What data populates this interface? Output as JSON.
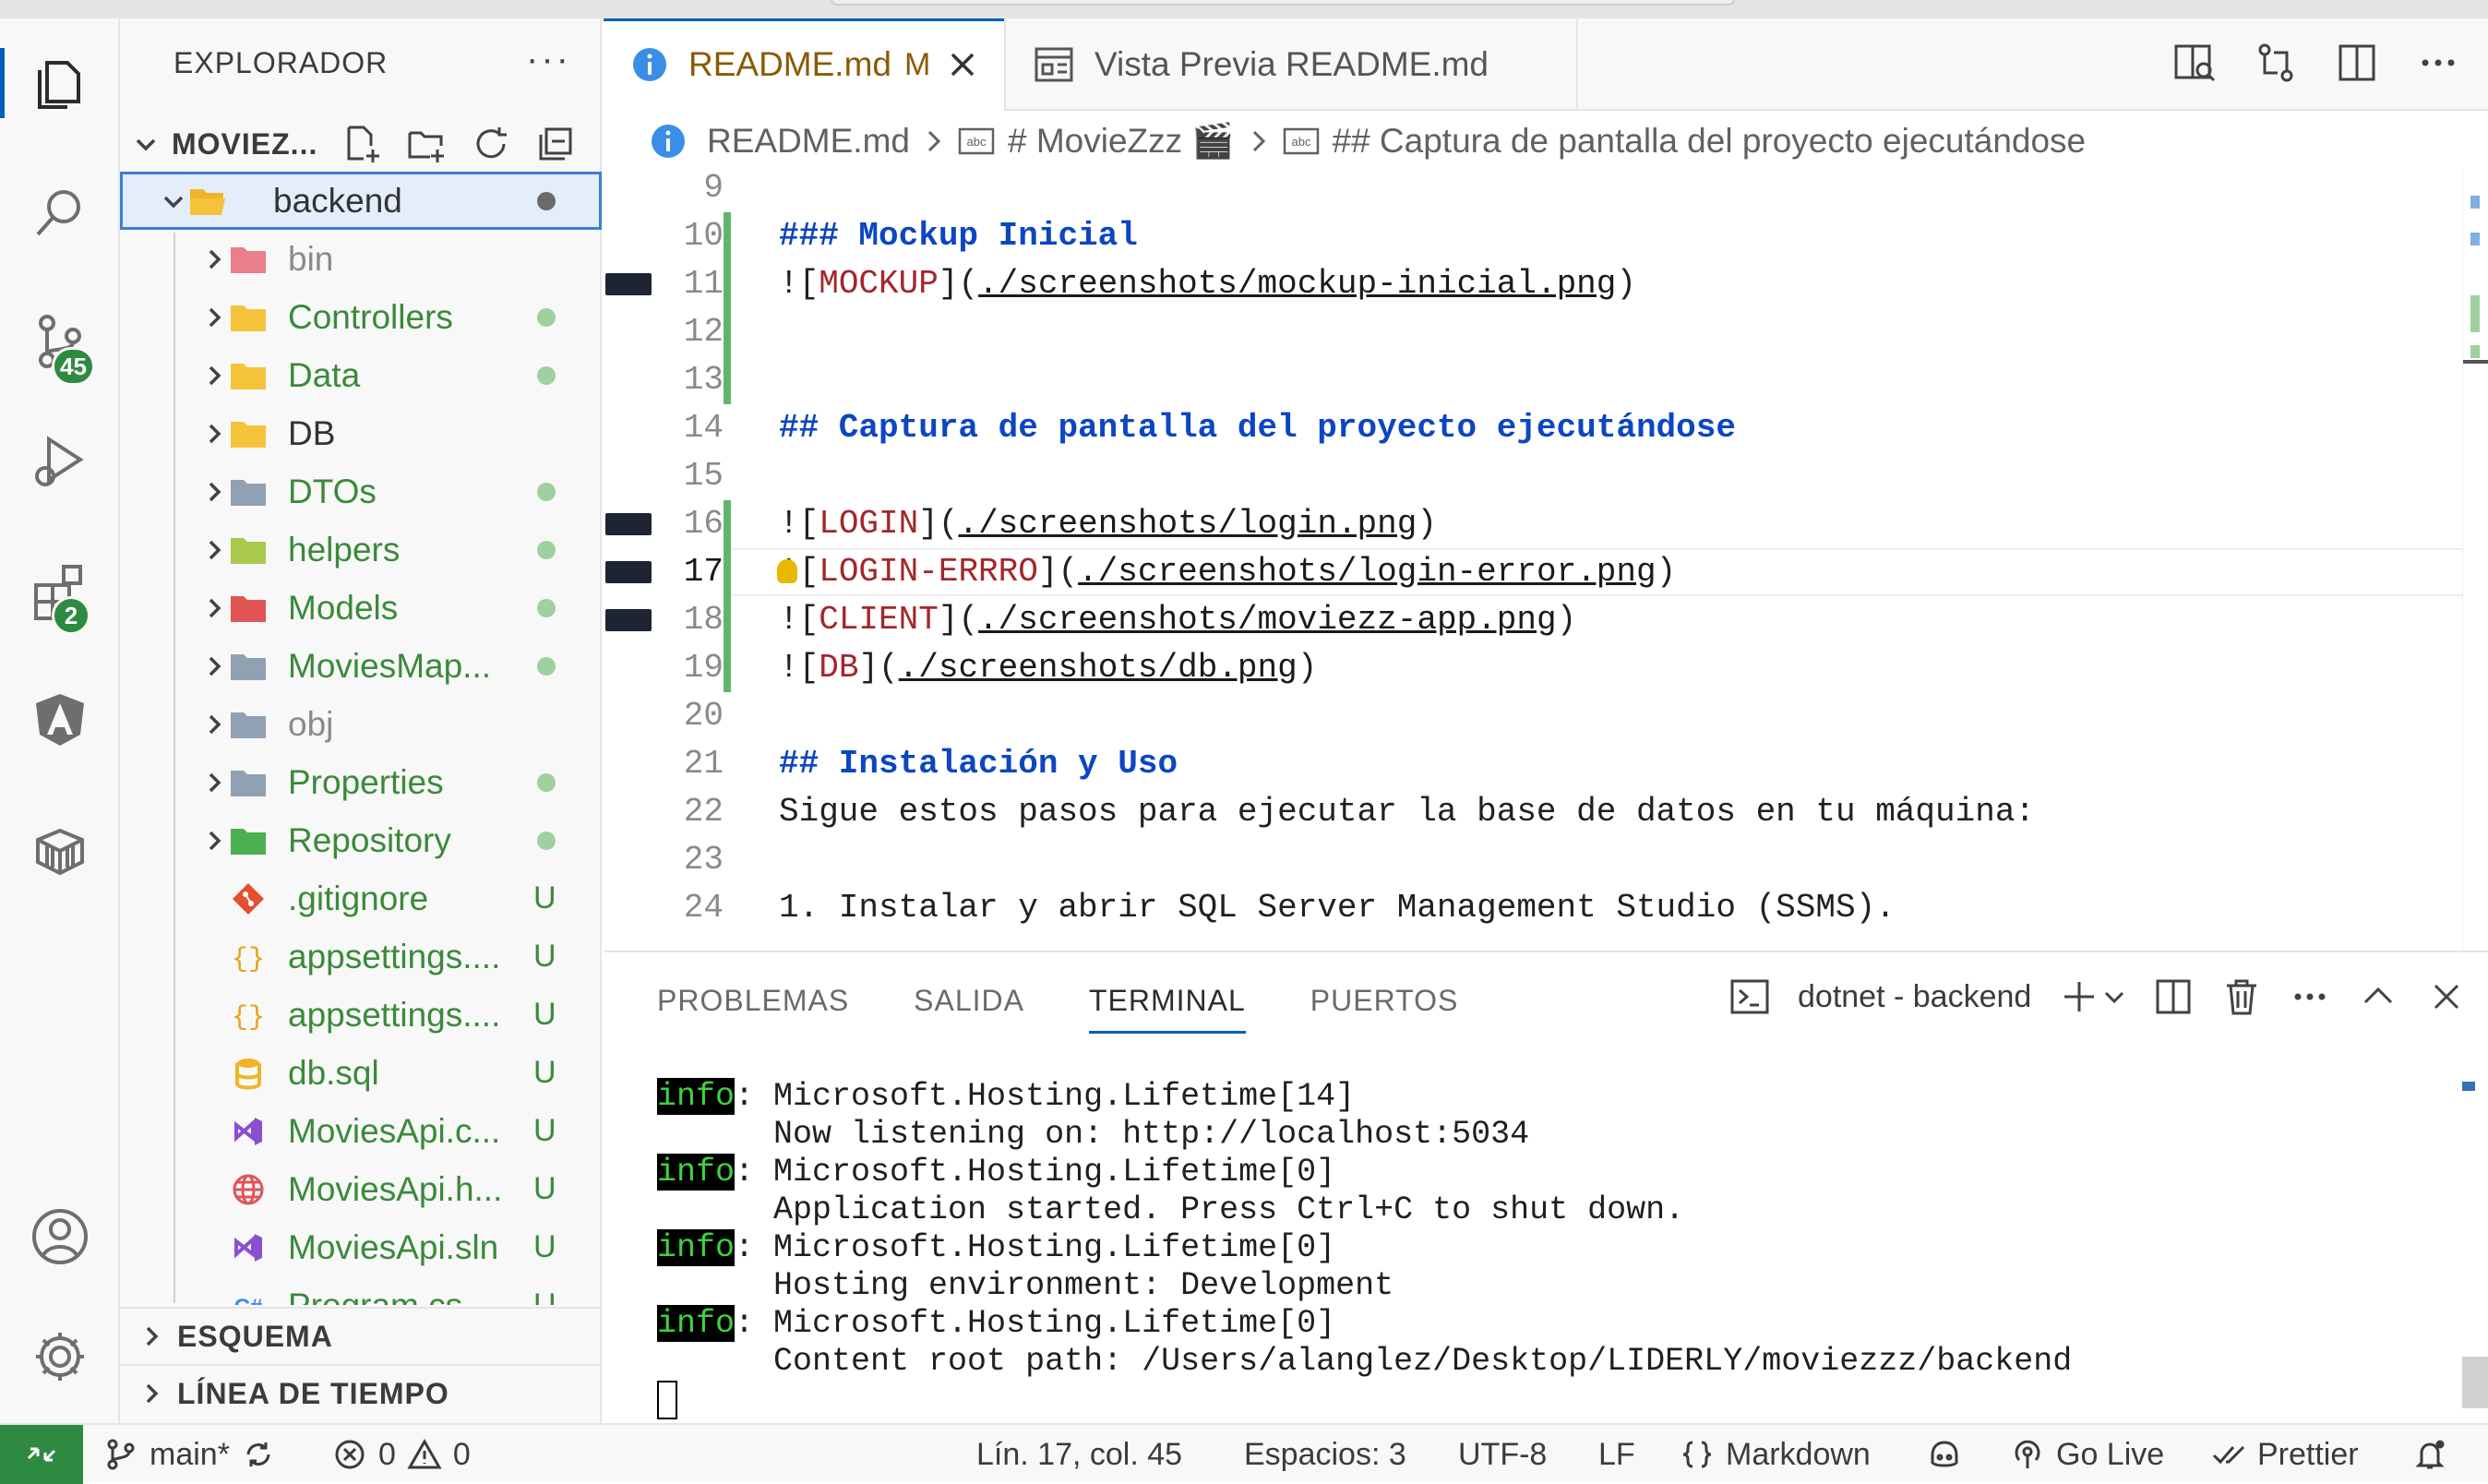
{
  "sidebar": {
    "title": "EXPLORADOR",
    "more": "···",
    "root": "MOVIEZ...",
    "items": [
      {
        "label": "backend",
        "type": "folder-open",
        "level": 0,
        "status": "dot-gray",
        "color": "#333333"
      },
      {
        "label": "bin",
        "type": "folder",
        "level": 1,
        "status": "",
        "color": "#8a8a8a",
        "icon_color": "#e87f8a"
      },
      {
        "label": "Controllers",
        "type": "folder",
        "level": 1,
        "status": "dot",
        "color": "#3a8a3a",
        "icon_color": "#f5c33b"
      },
      {
        "label": "Data",
        "type": "folder",
        "level": 1,
        "status": "dot",
        "color": "#3a8a3a",
        "icon_color": "#f5c33b"
      },
      {
        "label": "DB",
        "type": "folder",
        "level": 1,
        "status": "",
        "color": "#333333",
        "icon_color": "#f5c33b"
      },
      {
        "label": "DTOs",
        "type": "folder",
        "level": 1,
        "status": "dot",
        "color": "#3a8a3a",
        "icon_color": "#8fa1b3"
      },
      {
        "label": "helpers",
        "type": "folder",
        "level": 1,
        "status": "dot",
        "color": "#3a8a3a",
        "icon_color": "#a8c94c"
      },
      {
        "label": "Models",
        "type": "folder",
        "level": 1,
        "status": "dot",
        "color": "#3a8a3a",
        "icon_color": "#e05555"
      },
      {
        "label": "MoviesMap...",
        "type": "folder",
        "level": 1,
        "status": "dot",
        "color": "#3a8a3a",
        "icon_color": "#8fa1b3"
      },
      {
        "label": "obj",
        "type": "folder",
        "level": 1,
        "status": "",
        "color": "#8a8a8a",
        "icon_color": "#8fa1b3"
      },
      {
        "label": "Properties",
        "type": "folder",
        "level": 1,
        "status": "dot",
        "color": "#3a8a3a",
        "icon_color": "#8fa1b3"
      },
      {
        "label": "Repository",
        "type": "folder",
        "level": 1,
        "status": "dot",
        "color": "#3a8a3a",
        "icon_color": "#4caf50"
      },
      {
        "label": ".gitignore",
        "type": "file",
        "level": 1,
        "status": "U",
        "color": "#3a8a3a",
        "icon": "git-icon"
      },
      {
        "label": "appsettings....",
        "type": "file",
        "level": 1,
        "status": "U",
        "color": "#3a8a3a",
        "icon": "json-icon"
      },
      {
        "label": "appsettings....",
        "type": "file",
        "level": 1,
        "status": "U",
        "color": "#3a8a3a",
        "icon": "json-icon"
      },
      {
        "label": "db.sql",
        "type": "file",
        "level": 1,
        "status": "U",
        "color": "#3a8a3a",
        "icon": "database-icon"
      },
      {
        "label": "MoviesApi.c...",
        "type": "file",
        "level": 1,
        "status": "U",
        "color": "#3a8a3a",
        "icon": "visualstudio-icon"
      },
      {
        "label": "MoviesApi.h...",
        "type": "file",
        "level": 1,
        "status": "U",
        "color": "#3a8a3a",
        "icon": "globe-icon"
      },
      {
        "label": "MoviesApi.sln",
        "type": "file",
        "level": 1,
        "status": "U",
        "color": "#3a8a3a",
        "icon": "visualstudio-icon"
      },
      {
        "label": "Program.cs",
        "type": "file",
        "level": 1,
        "status": "U",
        "color": "#3a8a3a",
        "icon": "csharp-icon"
      }
    ],
    "sections": [
      "ESQUEMA",
      "LÍNEA DE TIEMPO"
    ]
  },
  "activity": {
    "source_control_badge": "45",
    "extensions_badge": "2"
  },
  "tabs": [
    {
      "label": "README.md",
      "modifier": "M",
      "active": true
    },
    {
      "label": "Vista Previa README.md",
      "modifier": "",
      "active": false
    }
  ],
  "breadcrumb": [
    "README.md",
    "# MovieZzz 🎬",
    "## Captura de pantalla del proyecto ejecutándose"
  ],
  "editor": {
    "current_line": 17,
    "lines": [
      {
        "n": "9",
        "t": ""
      },
      {
        "n": "10",
        "t": "### Mockup Inicial"
      },
      {
        "n": "11",
        "t": "![MOCKUP](./screenshots/mockup-inicial.png)"
      },
      {
        "n": "12",
        "t": ""
      },
      {
        "n": "13",
        "t": ""
      },
      {
        "n": "14",
        "t": "## Captura de pantalla del proyecto ejecutándose"
      },
      {
        "n": "15",
        "t": ""
      },
      {
        "n": "16",
        "t": "![LOGIN](./screenshots/login.png)"
      },
      {
        "n": "17",
        "t": "![LOGIN-ERRRO](./screenshots/login-error.png)"
      },
      {
        "n": "18",
        "t": "![CLIENT](./screenshots/moviezz-app.png)"
      },
      {
        "n": "19",
        "t": "![DB](./screenshots/db.png)"
      },
      {
        "n": "20",
        "t": ""
      },
      {
        "n": "21",
        "t": "## Instalación y Uso"
      },
      {
        "n": "22",
        "t": "Sigue estos pasos para ejecutar la base de datos en tu máquina:"
      },
      {
        "n": "23",
        "t": ""
      },
      {
        "n": "24",
        "t": "1. Instalar y abrir SQL Server Management Studio (SSMS)."
      }
    ]
  },
  "panel": {
    "tabs": [
      "PROBLEMAS",
      "SALIDA",
      "TERMINAL",
      "PUERTOS"
    ],
    "active_tab": "TERMINAL",
    "terminal_name": "dotnet - backend",
    "terminal_lines": [
      {
        "tag": "info",
        "text": ": Microsoft.Hosting.Lifetime[14]"
      },
      {
        "tag": "",
        "text": "      Now listening on: http://localhost:5034"
      },
      {
        "tag": "info",
        "text": ": Microsoft.Hosting.Lifetime[0]"
      },
      {
        "tag": "",
        "text": "      Application started. Press Ctrl+C to shut down."
      },
      {
        "tag": "info",
        "text": ": Microsoft.Hosting.Lifetime[0]"
      },
      {
        "tag": "",
        "text": "      Hosting environment: Development"
      },
      {
        "tag": "info",
        "text": ": Microsoft.Hosting.Lifetime[0]"
      },
      {
        "tag": "",
        "text": "      Content root path: /Users/alanglez/Desktop/LIDERLY/moviezzz/backend"
      }
    ]
  },
  "status": {
    "branch": "main*",
    "errors": "0",
    "warnings": "0",
    "position": "Lín. 17, col. 45",
    "spaces": "Espacios: 3",
    "encoding": "UTF-8",
    "eol": "LF",
    "language": "Markdown",
    "golive": "Go Live",
    "prettier": "Prettier"
  },
  "colors": {
    "accent": "#005fb8",
    "git_green": "#2e8a41",
    "heading": "#0c46c2",
    "link_text": "#a3262b"
  }
}
